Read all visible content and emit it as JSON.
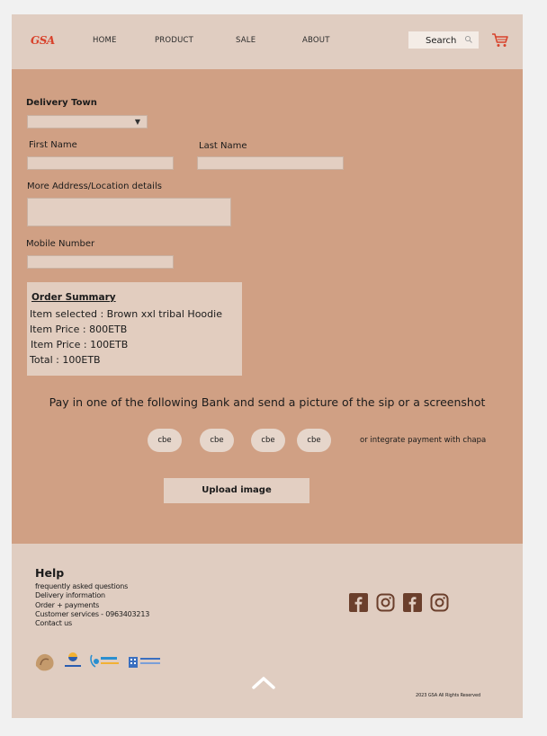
{
  "header": {
    "logo": "GSA",
    "nav": [
      "HOME",
      "PRODUCT",
      "SALE",
      "ABOUT"
    ],
    "search_label": "Search",
    "colors": {
      "background": "#e0cdc1",
      "logo": "#d8412a",
      "cart": "#d8412a"
    }
  },
  "form": {
    "delivery_town_label": "Delivery  Town",
    "delivery_town_value": "",
    "first_name_label": "First Name",
    "last_name_label": "Last Name",
    "address_label": "More Address/Location details",
    "mobile_label": "Mobile Number"
  },
  "order_summary": {
    "title": "Order Summary",
    "lines": [
      "Item selected : Brown xxl tribal Hoodie",
      "Item Price : 800ETB",
      " Item Price : 100ETB",
      "Total : 100ETB"
    ]
  },
  "payment": {
    "instruction": "Pay in one of the following Bank and send a picture of the sip or a screenshot",
    "banks": [
      "cbe",
      "cbe",
      "cbe",
      "cbe"
    ],
    "chapa_text": "or integrate payment with chapa",
    "upload_label": "Upload image",
    "colors": {
      "main_background": "#d0a084",
      "field": "#e3cfc2"
    }
  },
  "footer": {
    "help_title": "Help",
    "links": [
      "frequently asked questions",
      "Delivery information",
      "Order + payments",
      "Customer services - 0963403213",
      "Contact us"
    ],
    "social_icons": [
      "facebook-icon",
      "instagram-icon",
      "facebook-icon",
      "instagram-icon"
    ],
    "copyright": "2023 GSA All Rights Reserved",
    "colors": {
      "social": "#6b3f2c"
    }
  }
}
